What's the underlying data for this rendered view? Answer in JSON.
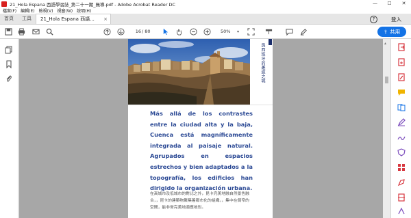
{
  "window": {
    "title": "21_Hola Espana 西語學習誌_第二十一期_無導.pdf - Adobe Acrobat Reader DC",
    "controls": [
      "—",
      "☐",
      "✕"
    ]
  },
  "menu": [
    "檔案(F)",
    "編輯(E)",
    "檢視(V)",
    "視窗(W)",
    "說明(H)"
  ],
  "tabs": {
    "home": "首頁",
    "tools": "工具",
    "document": "21_Hola Espana 西語...",
    "close": "×",
    "help": "?",
    "login": "登入"
  },
  "toolbar": {
    "page_current": "16",
    "page_total": "/ 80",
    "zoom": "50%",
    "share_label": "共用"
  },
  "page": {
    "vertical_title": "與西班牙的邂逅之城",
    "spanish_text": "Más allá de los contrastes entre la ciudad alta y la baja, Cuenca está magníficamente integrada al paisaje natural. Agrupados en espacios estrechos y bien adaptados a la topografía, los edificios han dirigido la organización urbana.",
    "chinese_text": "在高城市及低城市的對比之外，昆卡完美地融自然景色融合，，昆卡的建築物聚集着都市化的組織，，集中在侷窄的空間，能非常完美地適應地形。"
  },
  "colors": {
    "accent": "#1473e6",
    "spanish_text": "#2c4a95",
    "doc_bg": "#a7a7a7"
  }
}
